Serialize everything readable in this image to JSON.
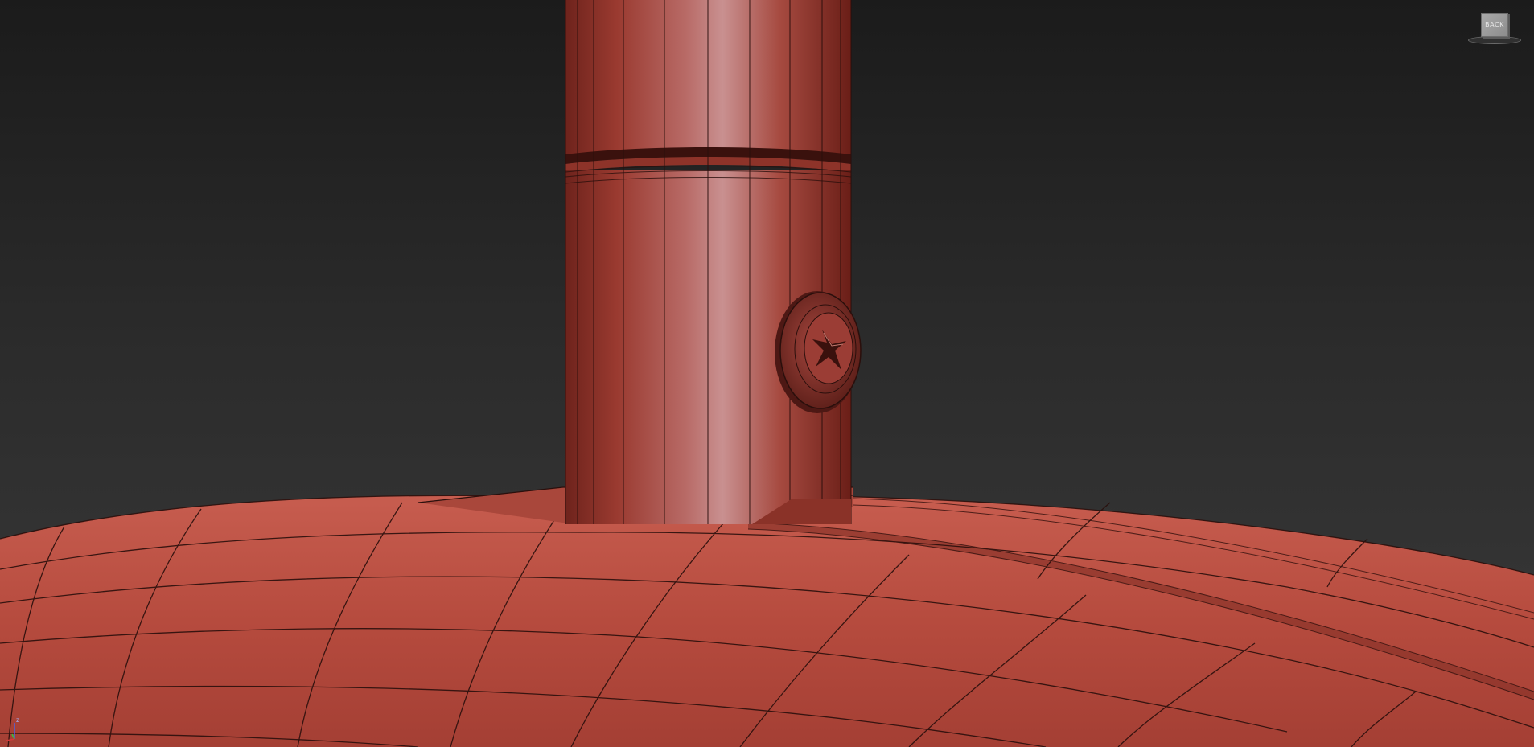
{
  "viewport": {
    "background_top": "#1b1b1b",
    "background_bottom": "#3a3a3a"
  },
  "model": {
    "base_color": "#b54a3d",
    "pipe_color": "#a3433a",
    "pipe_highlight": "#c98a8a",
    "edge_color": "#2a0f0c"
  },
  "viewcube": {
    "face_label": "BACK"
  },
  "axis": {
    "z_label": "z",
    "x_color": "#d23a3a",
    "y_color": "#3ac23a",
    "z_color": "#4a62e0"
  }
}
